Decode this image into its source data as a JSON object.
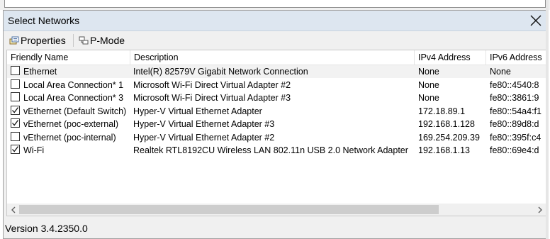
{
  "window": {
    "title": "Select Networks",
    "close_icon": "close-icon"
  },
  "toolbar": {
    "properties_label": "Properties",
    "pmode_label": "P-Mode"
  },
  "table": {
    "columns": [
      "Friendly Name",
      "Description",
      "IPv4 Address",
      "IPv6 Address"
    ],
    "rows": [
      {
        "checked": false,
        "name": "Ethernet",
        "description": "Intel(R) 82579V Gigabit Network Connection",
        "ipv4": "None",
        "ipv6": "None"
      },
      {
        "checked": false,
        "name": "Local Area Connection* 1",
        "description": "Microsoft Wi-Fi Direct Virtual Adapter #2",
        "ipv4": "None",
        "ipv6": "fe80::4540:8"
      },
      {
        "checked": false,
        "name": "Local Area Connection* 3",
        "description": "Microsoft Wi-Fi Direct Virtual Adapter #3",
        "ipv4": "None",
        "ipv6": "fe80::3861:9"
      },
      {
        "checked": true,
        "name": "vEthernet (Default Switch)",
        "description": "Hyper-V Virtual Ethernet Adapter",
        "ipv4": "172.18.89.1",
        "ipv6": "fe80::54a4:f1"
      },
      {
        "checked": true,
        "name": "vEthernet (poc-external)",
        "description": "Hyper-V Virtual Ethernet Adapter #3",
        "ipv4": "192.168.1.128",
        "ipv6": "fe80::89d8:d"
      },
      {
        "checked": false,
        "name": "vEthernet (poc-internal)",
        "description": "Hyper-V Virtual Ethernet Adapter #2",
        "ipv4": "169.254.209.39",
        "ipv6": "fe80::395f:c4"
      },
      {
        "checked": true,
        "name": "Wi-Fi",
        "description": "Realtek RTL8192CU Wireless LAN 802.11n USB 2.0 Network Adapter",
        "ipv4": "192.168.1.13",
        "ipv6": "fe80::69e4:d"
      }
    ]
  },
  "status": {
    "version": "Version 3.4.2350.0"
  },
  "colors": {
    "titlebar": "#dde6f0",
    "alt_row": "#f2f2f2",
    "scroll_thumb": "#cdcdcd"
  }
}
